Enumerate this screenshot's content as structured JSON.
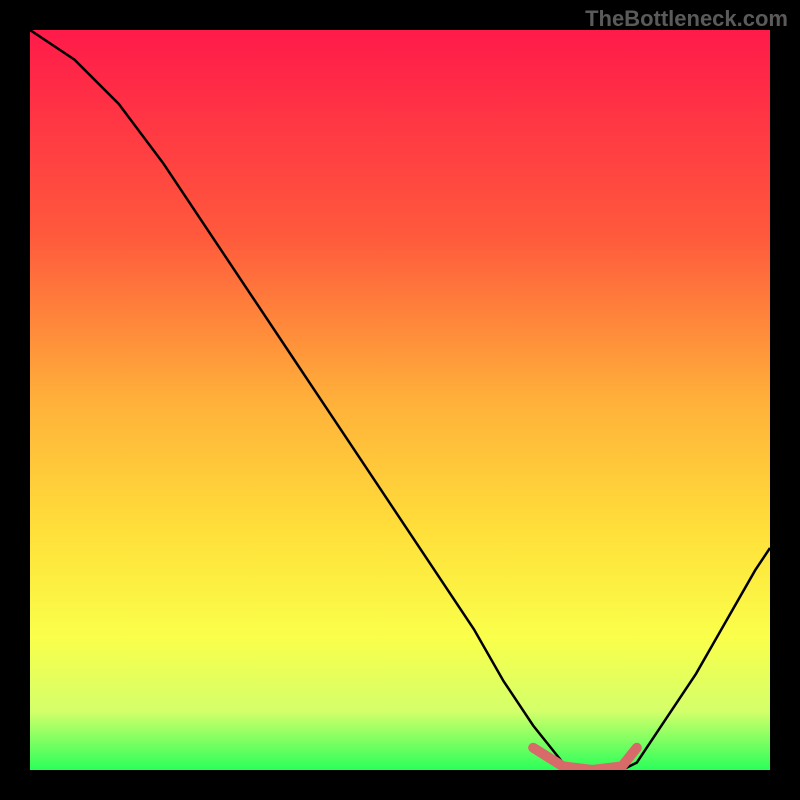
{
  "watermark": "TheBottleneck.com",
  "chart_data": {
    "type": "line",
    "title": "",
    "xlabel": "",
    "ylabel": "",
    "xlim": [
      0,
      100
    ],
    "ylim": [
      0,
      100
    ],
    "gradient_stops": [
      {
        "offset": 0,
        "color": "#ff1a4a"
      },
      {
        "offset": 28,
        "color": "#ff5a3c"
      },
      {
        "offset": 50,
        "color": "#ffb03a"
      },
      {
        "offset": 68,
        "color": "#ffe03a"
      },
      {
        "offset": 82,
        "color": "#faff4a"
      },
      {
        "offset": 92,
        "color": "#d4ff6a"
      },
      {
        "offset": 100,
        "color": "#2aff5a"
      }
    ],
    "series": [
      {
        "name": "bottleneck-curve",
        "color": "#000000",
        "x": [
          0,
          6,
          12,
          18,
          24,
          30,
          36,
          42,
          48,
          54,
          60,
          64,
          68,
          72,
          76,
          80,
          82,
          86,
          90,
          94,
          98,
          100
        ],
        "y": [
          100,
          96,
          90,
          82,
          73,
          64,
          55,
          46,
          37,
          28,
          19,
          12,
          6,
          1,
          0,
          0,
          1,
          7,
          13,
          20,
          27,
          30
        ]
      },
      {
        "name": "optimal-band",
        "color": "#d86a6a",
        "x": [
          68,
          72,
          76,
          80,
          82
        ],
        "y": [
          3,
          0.5,
          0,
          0.5,
          3
        ]
      }
    ]
  }
}
